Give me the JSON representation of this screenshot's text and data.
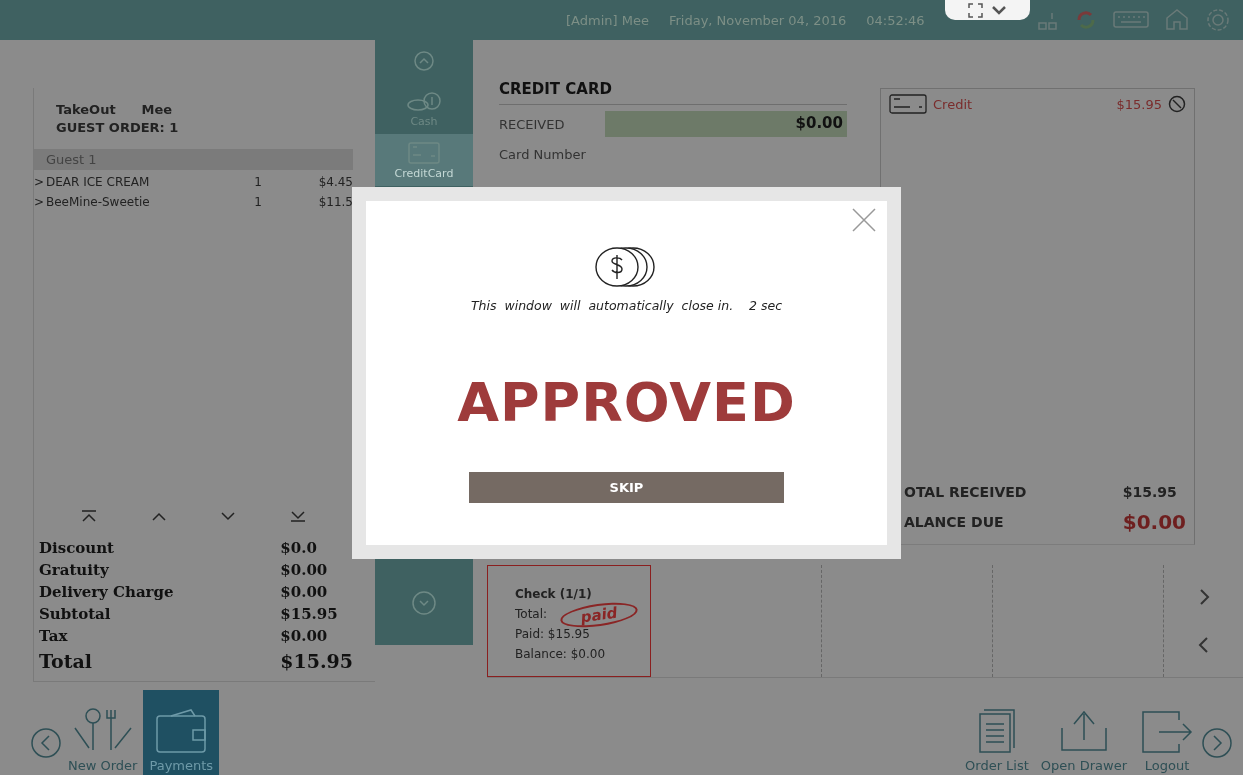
{
  "header": {
    "user": "[Admin] Mee",
    "date": "Friday, November 04, 2016",
    "time": "04:52:46"
  },
  "order": {
    "type": "TakeOut",
    "server": "Mee",
    "guest_order": "GUEST ORDER: 1",
    "guest": "Guest 1",
    "items": [
      {
        "marker": ">",
        "name": "DEAR ICE CREAM",
        "qty": "1",
        "price": "$4.45"
      },
      {
        "marker": ">",
        "name": "BeeMine-Sweetie",
        "qty": "1",
        "price": "$11.5"
      }
    ],
    "summary": [
      {
        "label": "Discount",
        "value": "$0.0",
        "kind": "normal"
      },
      {
        "label": "Gratuity",
        "value": "$0.00",
        "kind": "normal"
      },
      {
        "label": "Delivery Charge",
        "value": "$0.00",
        "kind": "normal"
      },
      {
        "label": "Subtotal",
        "value": "$15.95",
        "kind": "normal"
      },
      {
        "label": "Tax",
        "value": "$0.00",
        "kind": "normal"
      },
      {
        "label": "Total",
        "value": "$15.95",
        "kind": "total"
      }
    ]
  },
  "payment_methods": [
    {
      "label": "Cash",
      "kind": "cash",
      "selected": false
    },
    {
      "label": "CreditCard",
      "kind": "card",
      "selected": true
    }
  ],
  "credit_card": {
    "title": "CREDIT CARD",
    "received_label": "RECEIVED",
    "received_value": "$0.00",
    "card_number_label": "Card Number"
  },
  "payments": {
    "entries": [
      {
        "method": "Credit",
        "amount": "$15.95"
      }
    ],
    "total_received_label": "OTAL RECEIVED",
    "total_received": "$15.95",
    "balance_due_label": "ALANCE DUE",
    "balance_due": "$0.00"
  },
  "checks": [
    {
      "title": "Check (1/1)",
      "total_label": "Total:",
      "paid": "Paid: $15.95",
      "balance": "Balance: $0.00",
      "stamp": "paid"
    }
  ],
  "bottom_bar": {
    "left": [
      {
        "label": "New Order",
        "kind": "new-order",
        "selected": false
      },
      {
        "label": "Payments",
        "kind": "payments",
        "selected": true
      }
    ],
    "right": [
      {
        "label": "Order List",
        "kind": "order-list"
      },
      {
        "label": "Open Drawer",
        "kind": "drawer"
      },
      {
        "label": "Logout",
        "kind": "logout"
      }
    ]
  },
  "dialog": {
    "message": "This  window  will  automatically  close in.",
    "countdown": "2 sec",
    "status": "APPROVED",
    "button": "SKIP"
  }
}
